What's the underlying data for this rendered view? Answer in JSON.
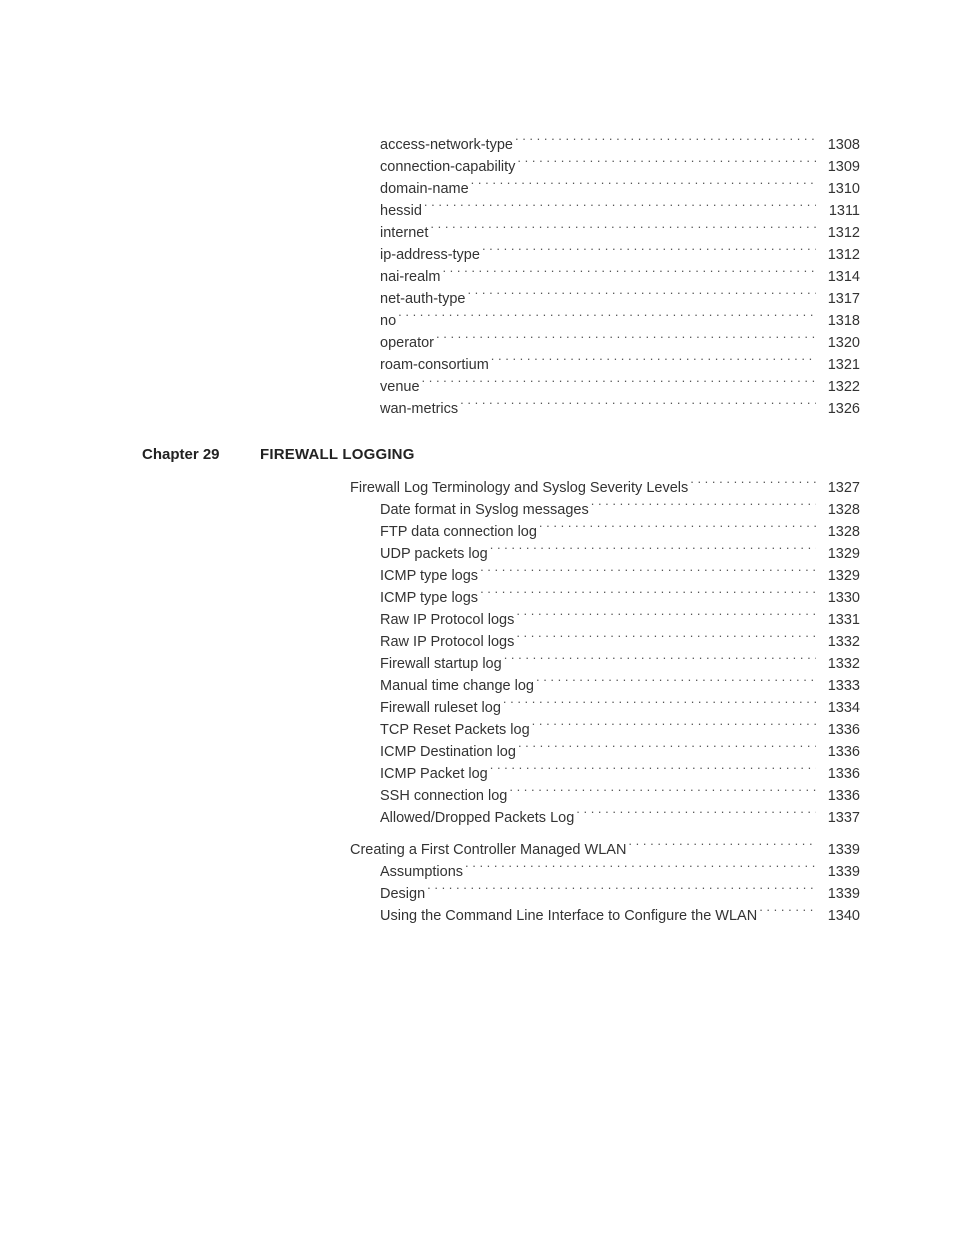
{
  "sections": [
    {
      "chapter_label": null,
      "heading": null,
      "groups": [
        {
          "entries": [
            {
              "level": 0,
              "text": "access-network-type",
              "page": "1308"
            },
            {
              "level": 0,
              "text": "connection-capability",
              "page": "1309"
            },
            {
              "level": 0,
              "text": "domain-name",
              "page": "1310"
            },
            {
              "level": 0,
              "text": "hessid",
              "page": "1311"
            },
            {
              "level": 0,
              "text": "internet",
              "page": "1312"
            },
            {
              "level": 0,
              "text": "ip-address-type",
              "page": "1312"
            },
            {
              "level": 0,
              "text": "nai-realm",
              "page": "1314"
            },
            {
              "level": 0,
              "text": "net-auth-type",
              "page": "1317"
            },
            {
              "level": 0,
              "text": "no",
              "page": "1318"
            },
            {
              "level": 0,
              "text": "operator",
              "page": "1320"
            },
            {
              "level": 0,
              "text": "roam-consortium",
              "page": "1321"
            },
            {
              "level": 0,
              "text": "venue",
              "page": "1322"
            },
            {
              "level": 0,
              "text": "wan-metrics",
              "page": "1326"
            }
          ]
        }
      ]
    },
    {
      "chapter_label": "Chapter 29",
      "heading": "FIREWALL LOGGING",
      "groups": [
        {
          "entries": [
            {
              "level": 1,
              "text": "Firewall Log Terminology and Syslog Severity Levels",
              "page": "1327"
            },
            {
              "level": 2,
              "text": "Date format in Syslog messages",
              "page": "1328"
            },
            {
              "level": 2,
              "text": "FTP data connection log",
              "page": "1328"
            },
            {
              "level": 2,
              "text": "UDP packets log",
              "page": "1329"
            },
            {
              "level": 2,
              "text": "ICMP type logs",
              "page": "1329"
            },
            {
              "level": 2,
              "text": "ICMP type logs",
              "page": "1330"
            },
            {
              "level": 2,
              "text": "Raw IP Protocol logs",
              "page": "1331"
            },
            {
              "level": 2,
              "text": "Raw IP Protocol logs",
              "page": "1332"
            },
            {
              "level": 2,
              "text": "Firewall startup log",
              "page": "1332"
            },
            {
              "level": 2,
              "text": "Manual time change log",
              "page": "1333"
            },
            {
              "level": 2,
              "text": "Firewall ruleset log",
              "page": "1334"
            },
            {
              "level": 2,
              "text": "TCP Reset Packets log",
              "page": "1336"
            },
            {
              "level": 2,
              "text": "ICMP Destination log",
              "page": "1336"
            },
            {
              "level": 2,
              "text": "ICMP Packet log",
              "page": "1336"
            },
            {
              "level": 2,
              "text": "SSH connection log",
              "page": "1336"
            },
            {
              "level": 2,
              "text": "Allowed/Dropped Packets Log",
              "page": "1337"
            }
          ]
        },
        {
          "entries": [
            {
              "level": 1,
              "text": "Creating a First Controller Managed WLAN",
              "page": "1339"
            },
            {
              "level": 2,
              "text": "Assumptions",
              "page": "1339"
            },
            {
              "level": 2,
              "text": "Design",
              "page": "1339"
            },
            {
              "level": 2,
              "text": "Using the Command Line Interface to Configure the WLAN",
              "page": "1340"
            }
          ]
        }
      ]
    }
  ]
}
